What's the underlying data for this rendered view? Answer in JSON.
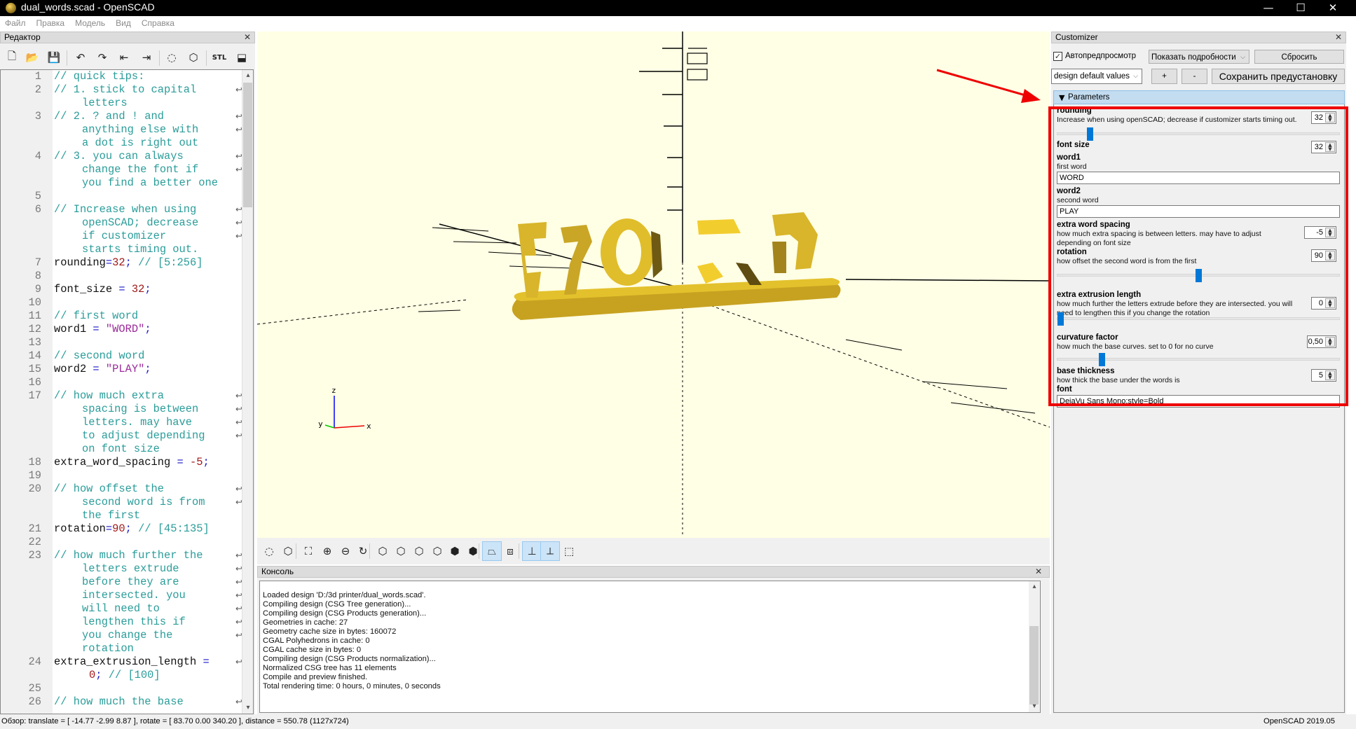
{
  "window": {
    "title": "dual_words.scad - OpenSCAD",
    "controls": {
      "minimize": "—",
      "maximize": "☐",
      "close": "✕"
    }
  },
  "menubar": [
    "Файл",
    "Правка",
    "Модель",
    "Вид",
    "Справка"
  ],
  "editor": {
    "title": "Редактор",
    "toolbar": [
      {
        "name": "new-file-icon",
        "glyph": "🗋"
      },
      {
        "name": "open-file-icon",
        "glyph": "📂"
      },
      {
        "name": "save-icon",
        "glyph": "💾"
      },
      {
        "name": "undo-icon",
        "glyph": "↶"
      },
      {
        "name": "redo-icon",
        "glyph": "↷"
      },
      {
        "name": "unindent-icon",
        "glyph": "⇤"
      },
      {
        "name": "indent-icon",
        "glyph": "⇥"
      },
      {
        "name": "preview-icon",
        "glyph": "◌"
      },
      {
        "name": "render-icon",
        "glyph": "⬡"
      },
      {
        "name": "export-stl-icon",
        "glyph": "STL"
      },
      {
        "name": "send-to-print-icon",
        "glyph": "⬓"
      }
    ],
    "lines": [
      {
        "n": "1",
        "parts": [
          [
            "c-comment",
            "// quick tips:"
          ]
        ]
      },
      {
        "n": "2",
        "parts": [
          [
            "c-comment",
            "// 1. stick to capital"
          ]
        ],
        "wrap": true
      },
      {
        "n": "",
        "cont": true,
        "parts": [
          [
            "c-comment",
            "letters"
          ]
        ]
      },
      {
        "n": "3",
        "parts": [
          [
            "c-comment",
            "// 2. ? and ! and"
          ]
        ],
        "wrap": true
      },
      {
        "n": "",
        "cont": true,
        "parts": [
          [
            "c-comment",
            "anything else with"
          ]
        ],
        "wrap": true
      },
      {
        "n": "",
        "cont": true,
        "parts": [
          [
            "c-comment",
            "a dot is right out"
          ]
        ]
      },
      {
        "n": "4",
        "parts": [
          [
            "c-comment",
            "// 3. you can always"
          ]
        ],
        "wrap": true
      },
      {
        "n": "",
        "cont": true,
        "parts": [
          [
            "c-comment",
            "change the font if"
          ]
        ],
        "wrap": true
      },
      {
        "n": "",
        "cont": true,
        "parts": [
          [
            "c-comment",
            "you find a better one"
          ]
        ]
      },
      {
        "n": "5",
        "parts": []
      },
      {
        "n": "6",
        "parts": [
          [
            "c-comment",
            "// Increase when using"
          ]
        ],
        "wrap": true
      },
      {
        "n": "",
        "cont": true,
        "parts": [
          [
            "c-comment",
            "openSCAD; decrease"
          ]
        ],
        "wrap": true
      },
      {
        "n": "",
        "cont": true,
        "parts": [
          [
            "c-comment",
            "if customizer"
          ]
        ],
        "wrap": true
      },
      {
        "n": "",
        "cont": true,
        "parts": [
          [
            "c-comment",
            "starts timing out."
          ]
        ]
      },
      {
        "n": "7",
        "parts": [
          [
            "c-id",
            "rounding"
          ],
          [
            "c-op",
            "="
          ],
          [
            "c-num",
            "32"
          ],
          [
            "c-op",
            ";"
          ],
          [
            "c-comment",
            " // [5:256]"
          ]
        ]
      },
      {
        "n": "8",
        "parts": []
      },
      {
        "n": "9",
        "parts": [
          [
            "c-id",
            "font_size "
          ],
          [
            "c-op",
            "="
          ],
          [
            "c-id",
            " "
          ],
          [
            "c-num",
            "32"
          ],
          [
            "c-op",
            ";"
          ]
        ]
      },
      {
        "n": "10",
        "parts": []
      },
      {
        "n": "11",
        "parts": [
          [
            "c-comment",
            "// first word"
          ]
        ]
      },
      {
        "n": "12",
        "parts": [
          [
            "c-id",
            "word1 "
          ],
          [
            "c-op",
            "="
          ],
          [
            "c-id",
            " "
          ],
          [
            "c-str",
            "\"WORD\""
          ],
          [
            "c-op",
            ";"
          ]
        ]
      },
      {
        "n": "13",
        "parts": []
      },
      {
        "n": "14",
        "parts": [
          [
            "c-comment",
            "// second word"
          ]
        ]
      },
      {
        "n": "15",
        "parts": [
          [
            "c-id",
            "word2 "
          ],
          [
            "c-op",
            "="
          ],
          [
            "c-id",
            " "
          ],
          [
            "c-str",
            "\"PLAY\""
          ],
          [
            "c-op",
            ";"
          ]
        ]
      },
      {
        "n": "16",
        "parts": []
      },
      {
        "n": "17",
        "parts": [
          [
            "c-comment",
            "// how much extra"
          ]
        ],
        "wrap": true
      },
      {
        "n": "",
        "cont": true,
        "parts": [
          [
            "c-comment",
            "spacing is between"
          ]
        ],
        "wrap": true
      },
      {
        "n": "",
        "cont": true,
        "parts": [
          [
            "c-comment",
            "letters. may have"
          ]
        ],
        "wrap": true
      },
      {
        "n": "",
        "cont": true,
        "parts": [
          [
            "c-comment",
            "to adjust depending"
          ]
        ],
        "wrap": true
      },
      {
        "n": "",
        "cont": true,
        "parts": [
          [
            "c-comment",
            "on font size"
          ]
        ]
      },
      {
        "n": "18",
        "parts": [
          [
            "c-id",
            "extra_word_spacing "
          ],
          [
            "c-op",
            "="
          ],
          [
            "c-id",
            " "
          ],
          [
            "c-num",
            "-5"
          ],
          [
            "c-op",
            ";"
          ]
        ]
      },
      {
        "n": "19",
        "parts": []
      },
      {
        "n": "20",
        "parts": [
          [
            "c-comment",
            "// how offset the"
          ]
        ],
        "wrap": true
      },
      {
        "n": "",
        "cont": true,
        "parts": [
          [
            "c-comment",
            "second word is from"
          ]
        ],
        "wrap": true
      },
      {
        "n": "",
        "cont": true,
        "parts": [
          [
            "c-comment",
            "the first"
          ]
        ]
      },
      {
        "n": "21",
        "parts": [
          [
            "c-id",
            "rotation"
          ],
          [
            "c-op",
            "="
          ],
          [
            "c-num",
            "90"
          ],
          [
            "c-op",
            ";"
          ],
          [
            "c-comment",
            " // [45:135]"
          ]
        ]
      },
      {
        "n": "22",
        "parts": []
      },
      {
        "n": "23",
        "parts": [
          [
            "c-comment",
            "// how much further the"
          ]
        ],
        "wrap": true
      },
      {
        "n": "",
        "cont": true,
        "parts": [
          [
            "c-comment",
            "letters extrude"
          ]
        ],
        "wrap": true
      },
      {
        "n": "",
        "cont": true,
        "parts": [
          [
            "c-comment",
            "before they are"
          ]
        ],
        "wrap": true
      },
      {
        "n": "",
        "cont": true,
        "parts": [
          [
            "c-comment",
            "intersected. you"
          ]
        ],
        "wrap": true
      },
      {
        "n": "",
        "cont": true,
        "parts": [
          [
            "c-comment",
            "will need to"
          ]
        ],
        "wrap": true
      },
      {
        "n": "",
        "cont": true,
        "parts": [
          [
            "c-comment",
            "lengthen this if"
          ]
        ],
        "wrap": true
      },
      {
        "n": "",
        "cont": true,
        "parts": [
          [
            "c-comment",
            "you change the"
          ]
        ],
        "wrap": true
      },
      {
        "n": "",
        "cont": true,
        "parts": [
          [
            "c-comment",
            "rotation"
          ]
        ]
      },
      {
        "n": "24",
        "parts": [
          [
            "c-id",
            "extra_extrusion_length "
          ],
          [
            "c-op",
            "="
          ]
        ],
        "wrap": true
      },
      {
        "n": "",
        "cont2": true,
        "parts": [
          [
            "c-num",
            "0"
          ],
          [
            "c-op",
            ";"
          ],
          [
            "c-comment",
            " // [100]"
          ]
        ]
      },
      {
        "n": "25",
        "parts": []
      },
      {
        "n": "26",
        "parts": [
          [
            "c-comment",
            "// how much the base"
          ]
        ],
        "wrap": true
      }
    ]
  },
  "viewport": {
    "axis_labels": {
      "x": "x",
      "y": "y",
      "z": "z"
    },
    "model_color": "#e8c22a",
    "background": "#ffffe5"
  },
  "view_toolbar": [
    {
      "name": "preview-icon",
      "glyph": "◌",
      "active": false
    },
    {
      "name": "render-icon",
      "glyph": "⬡",
      "active": false
    },
    {
      "name": "view-all-icon",
      "glyph": "⛶",
      "active": false
    },
    {
      "name": "zoom-in-icon",
      "glyph": "⊕",
      "active": false
    },
    {
      "name": "zoom-out-icon",
      "glyph": "⊖",
      "active": false
    },
    {
      "name": "reset-view-icon",
      "glyph": "↻",
      "active": false
    },
    {
      "name": "view-right-icon",
      "glyph": "⬡",
      "active": false
    },
    {
      "name": "view-top-icon",
      "glyph": "⬡",
      "active": false
    },
    {
      "name": "view-bottom-icon",
      "glyph": "⬡",
      "active": false
    },
    {
      "name": "view-left-icon",
      "glyph": "⬡",
      "active": false
    },
    {
      "name": "view-front-icon",
      "glyph": "⬢",
      "active": false
    },
    {
      "name": "view-back-icon",
      "glyph": "⬢",
      "active": false
    },
    {
      "name": "perspective-icon",
      "glyph": "⏢",
      "active": true
    },
    {
      "name": "orthogonal-icon",
      "glyph": "⧈",
      "active": false
    },
    {
      "name": "show-axes-icon",
      "glyph": "⊥",
      "active": true
    },
    {
      "name": "show-scale-markers-icon",
      "glyph": "⟂",
      "active": true
    },
    {
      "name": "show-edges-icon",
      "glyph": "⬚",
      "active": false
    }
  ],
  "console": {
    "title": "Консоль",
    "lines": [
      "Loaded design 'D:/3d printer/dual_words.scad'.",
      "Compiling design (CSG Tree generation)...",
      "Compiling design (CSG Products generation)...",
      "Geometries in cache: 27",
      "Geometry cache size in bytes: 160072",
      "CGAL Polyhedrons in cache: 0",
      "CGAL cache size in bytes: 0",
      "Compiling design (CSG Products normalization)...",
      "Normalized CSG tree has 11 elements",
      "Compile and preview finished.",
      "Total rendering time: 0 hours, 0 minutes, 0 seconds"
    ]
  },
  "customizer": {
    "title": "Customizer",
    "auto_preview_label": "Автопредпросмотр",
    "auto_preview_checked": true,
    "details_select": "Показать подробности",
    "reset_label": "Сбросить",
    "preset_select": "design default values",
    "add_label": "+",
    "remove_label": "-",
    "save_preset_label": "Сохранить предустановку",
    "params_header": "Parameters",
    "params": {
      "rounding": {
        "name": "rounding",
        "desc": "Increase when using openSCAD; decrease if customizer starts timing out.",
        "value": "32",
        "slider_fraction": 0.106
      },
      "font_size": {
        "name": "font size",
        "value": "32"
      },
      "word1": {
        "name": "word1",
        "desc": "first word",
        "value": "WORD"
      },
      "word2": {
        "name": "word2",
        "desc": "second word",
        "value": "PLAY"
      },
      "extra_word_spacing": {
        "name": "extra word spacing",
        "desc": "how much extra spacing is between letters. may have to adjust depending on font size",
        "value": "-5"
      },
      "rotation": {
        "name": "rotation",
        "desc": "how offset the second word is from the first",
        "value": "90",
        "slider_fraction": 0.5
      },
      "extra_extrusion_length": {
        "name": "extra extrusion length",
        "desc": "how much further the letters extrude before they are intersected. you will need to lengthen this if you change the rotation",
        "value": "0",
        "slider_fraction": 0.0
      },
      "curvature_factor": {
        "name": "curvature factor",
        "desc": "how much the base curves. set to 0 for no curve",
        "value": "0,50",
        "slider_fraction": 0.15
      },
      "base_thickness": {
        "name": "base thickness",
        "desc": "how thick the base under the words is",
        "value": "5"
      },
      "font": {
        "name": "font",
        "value": "DejaVu Sans Mono:style=Bold"
      }
    }
  },
  "annotation": {
    "color": "#e00000"
  },
  "statusbar": {
    "view_info": "Обзор: translate = [ -14.77 -2.99 8.87 ], rotate = [ 83.70 0.00 340.20 ], distance = 550.78 (1127x724)",
    "version": "OpenSCAD 2019.05"
  }
}
